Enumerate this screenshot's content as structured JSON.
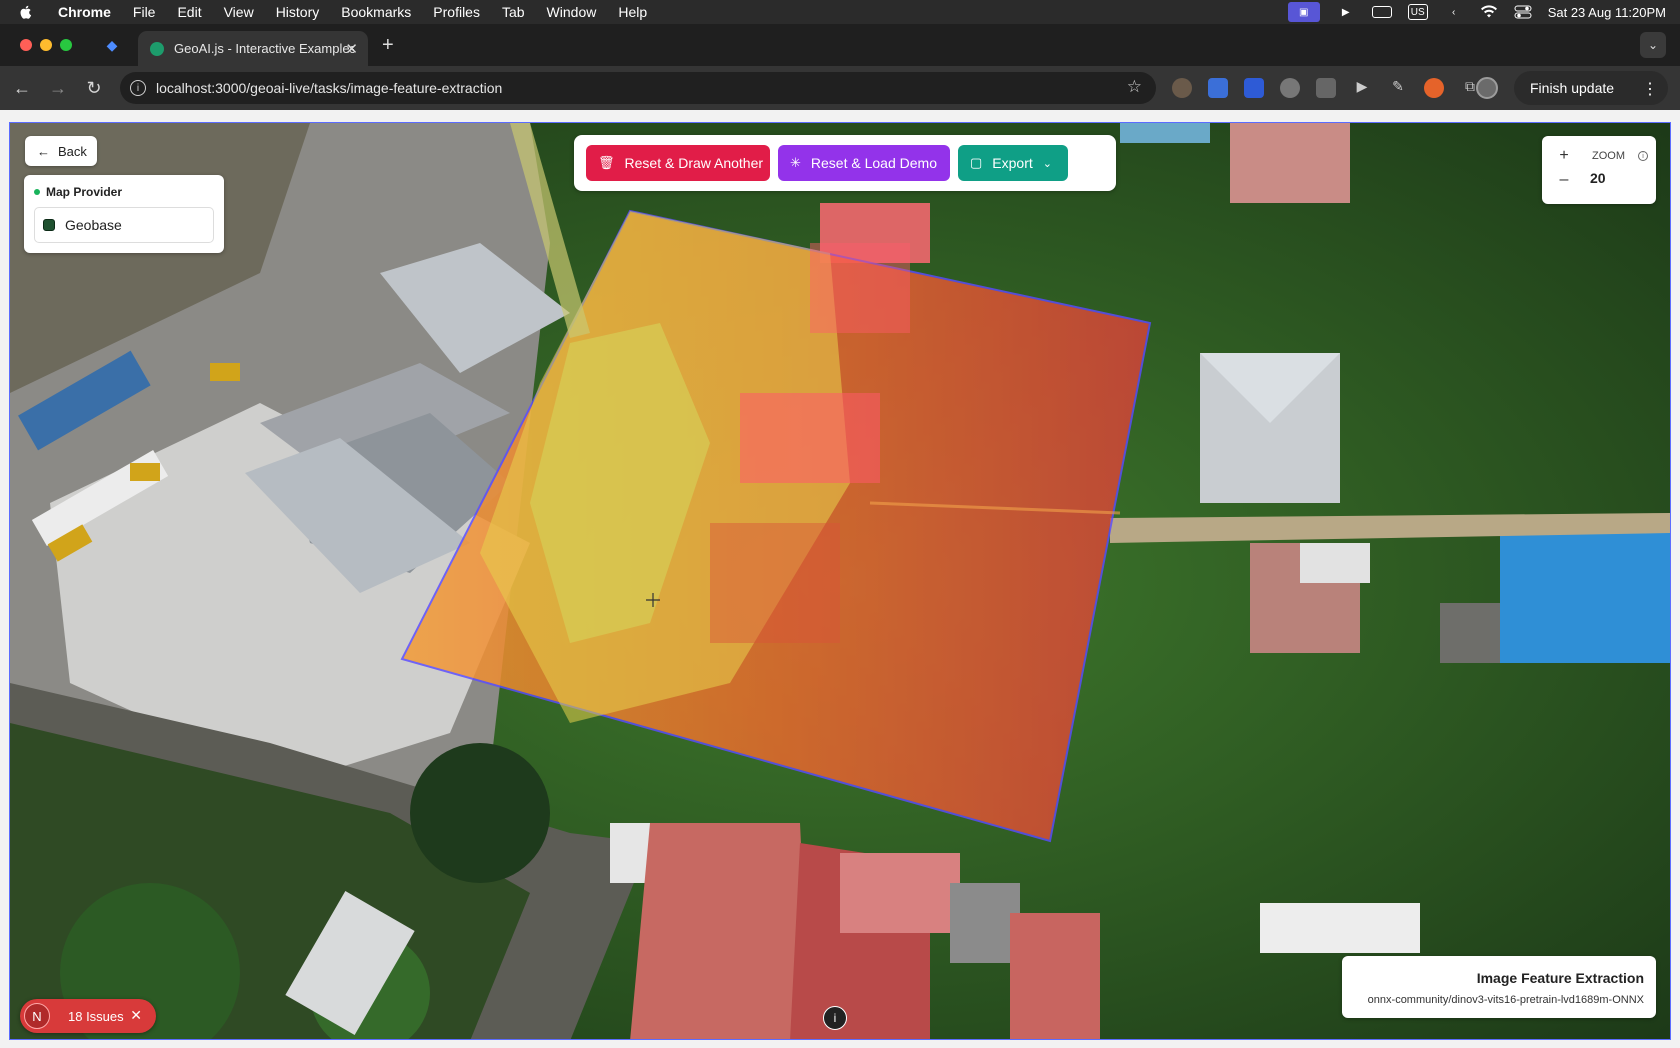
{
  "menubar": {
    "app": "Chrome",
    "items": [
      "File",
      "Edit",
      "View",
      "History",
      "Bookmarks",
      "Profiles",
      "Tab",
      "Window",
      "Help"
    ],
    "input_source": "US",
    "datetime": "Sat 23 Aug  11:20PM"
  },
  "browser": {
    "tab_title": "GeoAI.js - Interactive Examples",
    "url": "localhost:3000/geoai-live/tasks/image-feature-extraction",
    "finish_update": "Finish update"
  },
  "page": {
    "back": "Back",
    "provider_title": "Map Provider",
    "provider_option": "Geobase",
    "actions": {
      "reset_draw": "Reset & Draw Another",
      "reset_demo": "Reset & Load Demo",
      "export": "Export"
    },
    "zoom": {
      "label": "ZOOM",
      "value": "20",
      "plus": "+",
      "minus": "–"
    },
    "issues": {
      "logo": "N",
      "label": "18 Issues"
    },
    "task": {
      "title": "Image Feature Extraction",
      "model": "onnx-community/dinov3-vits16-pretrain-lvd1689m-ONNX"
    }
  },
  "colors": {
    "reset_draw": "#e11d48",
    "reset_demo": "#9333ea",
    "export": "#0f9f86",
    "overlay_orange": "#f07a2a",
    "overlay_yellow": "#e8d24c",
    "polygon_outline": "#5b4cff"
  }
}
